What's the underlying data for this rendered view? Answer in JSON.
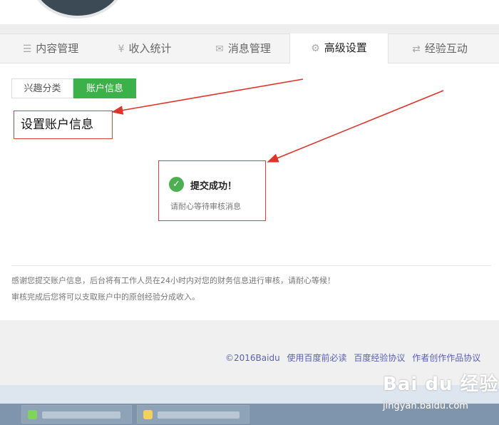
{
  "tabs": [
    {
      "icon": "list-icon",
      "glyph": "☰",
      "label": "内容管理"
    },
    {
      "icon": "yen-icon",
      "glyph": "¥",
      "label": "收入统计"
    },
    {
      "icon": "mail-icon",
      "glyph": "✉",
      "label": "消息管理"
    },
    {
      "icon": "gear-icon",
      "glyph": "⚙",
      "label": "高级设置",
      "active": true
    },
    {
      "icon": "exchange-icon",
      "glyph": "⇄",
      "label": "经验互动"
    }
  ],
  "subtabs": [
    {
      "label": "兴趣分类"
    },
    {
      "label": "账户信息",
      "active": true
    }
  ],
  "annotation": {
    "label": "设置账户信息"
  },
  "success": {
    "title": "提交成功！",
    "subtitle": "请耐心等待审核消息"
  },
  "notice": {
    "line1": "感谢您提交账户信息，后台将有工作人员在24小时内对您的财务信息进行审核，请耐心等候！",
    "line2": "审核完成后您将可以支取账户中的原创经验分成收入。"
  },
  "footer": {
    "copyright": "©2016Baidu",
    "links": [
      "使用百度前必读",
      "百度经验协议",
      "作者创作作品协议"
    ]
  },
  "watermark": {
    "logo": "Bai du 经验",
    "url": "jingyan.baidu.com"
  },
  "colors": {
    "accent_green": "#3cb14a",
    "annotation_red": "#d9453c",
    "link_blue": "#5a60b8"
  }
}
